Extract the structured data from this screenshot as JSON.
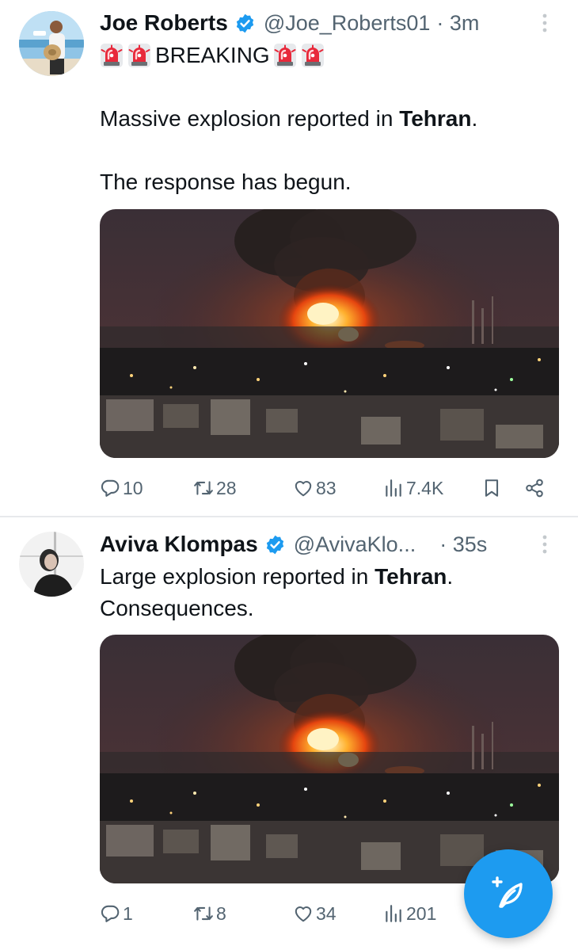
{
  "tweets": [
    {
      "author": "Joe Roberts",
      "handle": "@Joe_Roberts01",
      "time": "· 3m",
      "breaking": "BREAKING",
      "line1_prefix": "Massive explosion reported in ",
      "line1_bold": "Tehran",
      "line1_suffix": ".",
      "line2": "The response has begun.",
      "replies": "10",
      "reposts": "28",
      "likes": "83",
      "views": "7.4K"
    },
    {
      "author": "Aviva Klompas",
      "handle": "@AvivaKlo...",
      "time": "· 35s",
      "line1_prefix": "Large explosion reported in ",
      "line1_bold": "Tehran",
      "line1_suffix": ".",
      "line2": "Consequences.",
      "replies": "1",
      "reposts": "8",
      "likes": "34",
      "views": "201"
    }
  ],
  "icons": {
    "verified": "verified-badge-icon",
    "siren": "police-siren-emoji",
    "reply": "reply-icon",
    "repost": "repost-icon",
    "like": "heart-icon",
    "views": "views-chart-icon",
    "bookmark": "bookmark-icon",
    "share": "share-icon",
    "more": "more-vertical-icon",
    "compose": "compose-post-icon"
  },
  "colors": {
    "accent": "#1d9bf0",
    "text": "#0f1419",
    "secondary": "#536471",
    "divider": "#e7e9ec"
  }
}
